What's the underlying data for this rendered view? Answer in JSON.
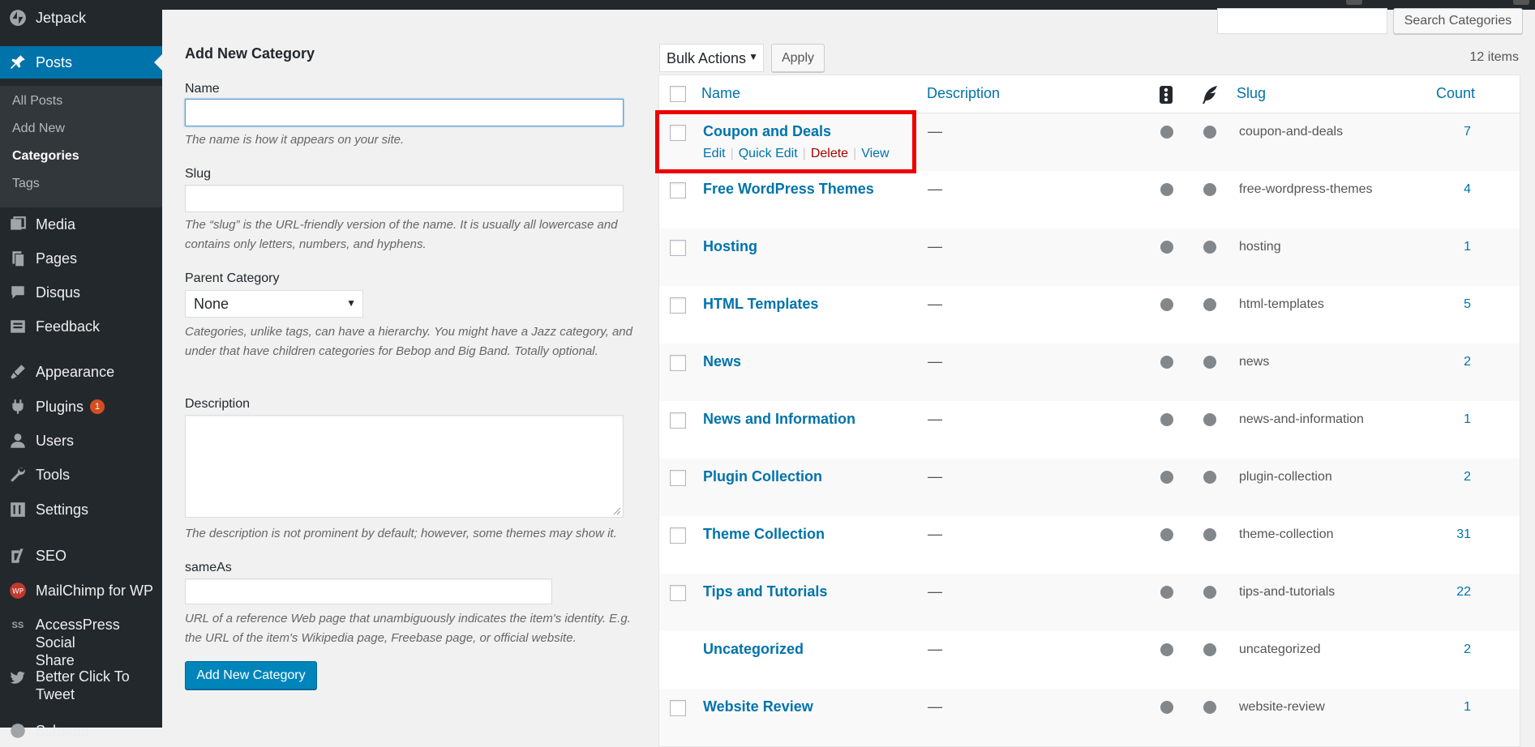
{
  "sidebar": {
    "items": [
      {
        "label": "Jetpack",
        "icon": "jetpack-icon"
      },
      {
        "label": "Posts",
        "icon": "pushpin-icon",
        "current": true
      },
      {
        "label": "Media",
        "icon": "media-icon"
      },
      {
        "label": "Pages",
        "icon": "pages-icon"
      },
      {
        "label": "Disqus",
        "icon": "comment-icon"
      },
      {
        "label": "Feedback",
        "icon": "feedback-icon"
      },
      {
        "label": "Appearance",
        "icon": "brush-icon"
      },
      {
        "label": "Plugins",
        "icon": "plugin-icon",
        "badge": "1"
      },
      {
        "label": "Users",
        "icon": "users-icon"
      },
      {
        "label": "Tools",
        "icon": "wrench-icon"
      },
      {
        "label": "Settings",
        "icon": "settings-icon"
      },
      {
        "label": "SEO",
        "icon": "yoast-icon"
      },
      {
        "label": "MailChimp for WP",
        "icon": "mailchimp-icon"
      },
      {
        "label_line1": "AccessPress Social",
        "label_line2": "Share",
        "icon": "ss-icon"
      },
      {
        "label_line1": "Better Click To",
        "label_line2": "Tweet",
        "icon": "twitter-icon"
      },
      {
        "label": "Schema",
        "icon": "schema-icon"
      }
    ],
    "submenu": [
      "All Posts",
      "Add New",
      "Categories",
      "Tags"
    ]
  },
  "form": {
    "title": "Add New Category",
    "name_label": "Name",
    "name_help": "The name is how it appears on your site.",
    "slug_label": "Slug",
    "slug_help": "The “slug” is the URL-friendly version of the name. It is usually all lowercase and contains only letters, numbers, and hyphens.",
    "parent_label": "Parent Category",
    "parent_value": "None",
    "parent_help": "Categories, unlike tags, can have a hierarchy. You might have a Jazz category, and under that have children categories for Bebop and Big Band. Totally optional.",
    "description_label": "Description",
    "description_help": "The description is not prominent by default; however, some themes may show it.",
    "sameas_label": "sameAs",
    "sameas_help": "URL of a reference Web page that unambiguously indicates the item's identity. E.g. the URL of the item's Wikipedia page, Freebase page, or official website.",
    "submit_label": "Add New Category"
  },
  "list": {
    "search_button": "Search Categories",
    "bulk_actions": "Bulk Actions",
    "apply": "Apply",
    "items_count": "12 items",
    "columns": {
      "name": "Name",
      "description": "Description",
      "slug": "Slug",
      "count": "Count"
    },
    "row_actions": {
      "edit": "Edit",
      "quick_edit": "Quick Edit",
      "delete": "Delete",
      "view": "View"
    },
    "rows": [
      {
        "name": "Coupon and Deals",
        "description": "—",
        "slug": "coupon-and-deals",
        "count": "7",
        "checkbox": true
      },
      {
        "name": "Free WordPress Themes",
        "description": "—",
        "slug": "free-wordpress-themes",
        "count": "4",
        "checkbox": true
      },
      {
        "name": "Hosting",
        "description": "—",
        "slug": "hosting",
        "count": "1",
        "checkbox": true
      },
      {
        "name": "HTML Templates",
        "description": "—",
        "slug": "html-templates",
        "count": "5",
        "checkbox": true
      },
      {
        "name": "News",
        "description": "—",
        "slug": "news",
        "count": "2",
        "checkbox": true
      },
      {
        "name": "News and Information",
        "description": "—",
        "slug": "news-and-information",
        "count": "1",
        "checkbox": true
      },
      {
        "name": "Plugin Collection",
        "description": "—",
        "slug": "plugin-collection",
        "count": "2",
        "checkbox": true
      },
      {
        "name": "Theme Collection",
        "description": "—",
        "slug": "theme-collection",
        "count": "31",
        "checkbox": true
      },
      {
        "name": "Tips and Tutorials",
        "description": "—",
        "slug": "tips-and-tutorials",
        "count": "22",
        "checkbox": true
      },
      {
        "name": "Uncategorized",
        "description": "—",
        "slug": "uncategorized",
        "count": "2",
        "checkbox": false
      },
      {
        "name": "Website Review",
        "description": "—",
        "slug": "website-review",
        "count": "1",
        "checkbox": true
      }
    ]
  },
  "colors": {
    "accent": "#0073aa",
    "highlight": "#ee0000",
    "sidebar": "#23282d"
  }
}
